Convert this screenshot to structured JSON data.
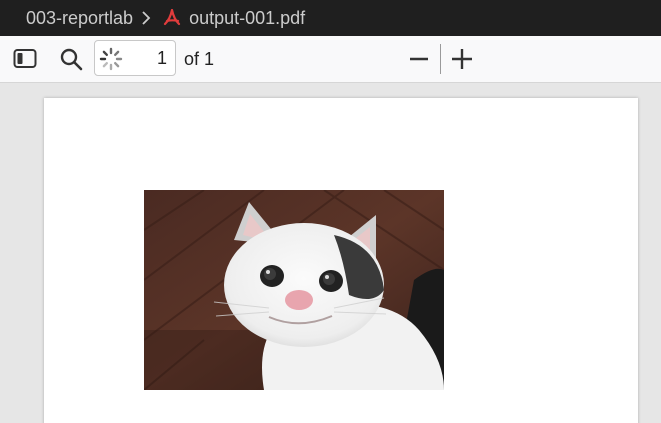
{
  "titlebar": {
    "folder": "003-reportlab",
    "separator_icon": "chevron-right-icon",
    "file_icon": "pdf-file-icon",
    "filename": "output-001.pdf"
  },
  "toolbar": {
    "sidebar_icon": "sidebar-toggle-icon",
    "search_icon": "search-icon",
    "loading_icon": "spinner-icon",
    "page_number": "1",
    "page_count": "of 1",
    "zoom_out_icon": "minus-icon",
    "zoom_in_icon": "plus-icon"
  },
  "document": {
    "image": "cat-photo"
  },
  "colors": {
    "titlebar_bg": "#1f1f1f",
    "toolbar_bg": "#f9f9fa",
    "viewer_bg": "#e6e6e6",
    "pdf_icon": "#e03c3c"
  }
}
